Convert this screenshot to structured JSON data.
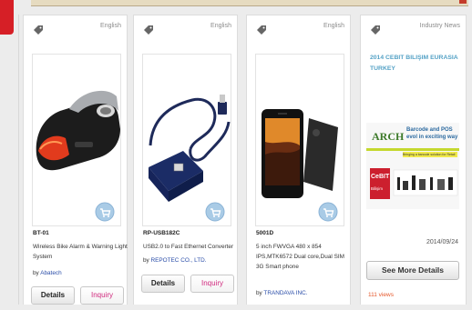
{
  "cards": [
    {
      "lang": "English",
      "name": "BT-01",
      "desc": "Wireless Bike Alarm & Warning Light System",
      "by_prefix": "by ",
      "by_vendor": "Abatech",
      "details_label": "Details",
      "inquiry_label": "Inquiry"
    },
    {
      "lang": "English",
      "name": "RP-USB182C",
      "desc": "USB2.0 to Fast Ethernet Converter",
      "by_prefix": "by ",
      "by_vendor": "REPOTEC CO., LTD.",
      "details_label": "Details",
      "inquiry_label": "Inquiry"
    },
    {
      "lang": "English",
      "name": "5001D",
      "desc": "5 inch FWVGA 480 x 854 IPS,MTK6572 Dual core,Dual SIM 3G Smart phone",
      "by_prefix": "by ",
      "by_vendor": "TRANDAVA INC."
    }
  ],
  "news": {
    "lang": "Industry News",
    "title": "2014 CEBIT BILIŞIM EURASIA TURKEY",
    "date": "2014/09/24",
    "see_more_label": "See More Details",
    "views": "111 views",
    "img_heading": "Barcode and POS evol in exciting way",
    "img_sub": "Bringing a barcode solution for Retail",
    "img_logo": "ARCH",
    "img_cebit": "CeBIT",
    "img_cebit_sub": "Bilişim"
  },
  "colors": {
    "accent_red": "#d61f26",
    "link_blue": "#2a4da8",
    "news_blue": "#55a2c6",
    "inquiry_pink": "#d02a7e",
    "views_orange": "#e5572a"
  },
  "icons": [
    "tag-icon",
    "cart-icon"
  ]
}
